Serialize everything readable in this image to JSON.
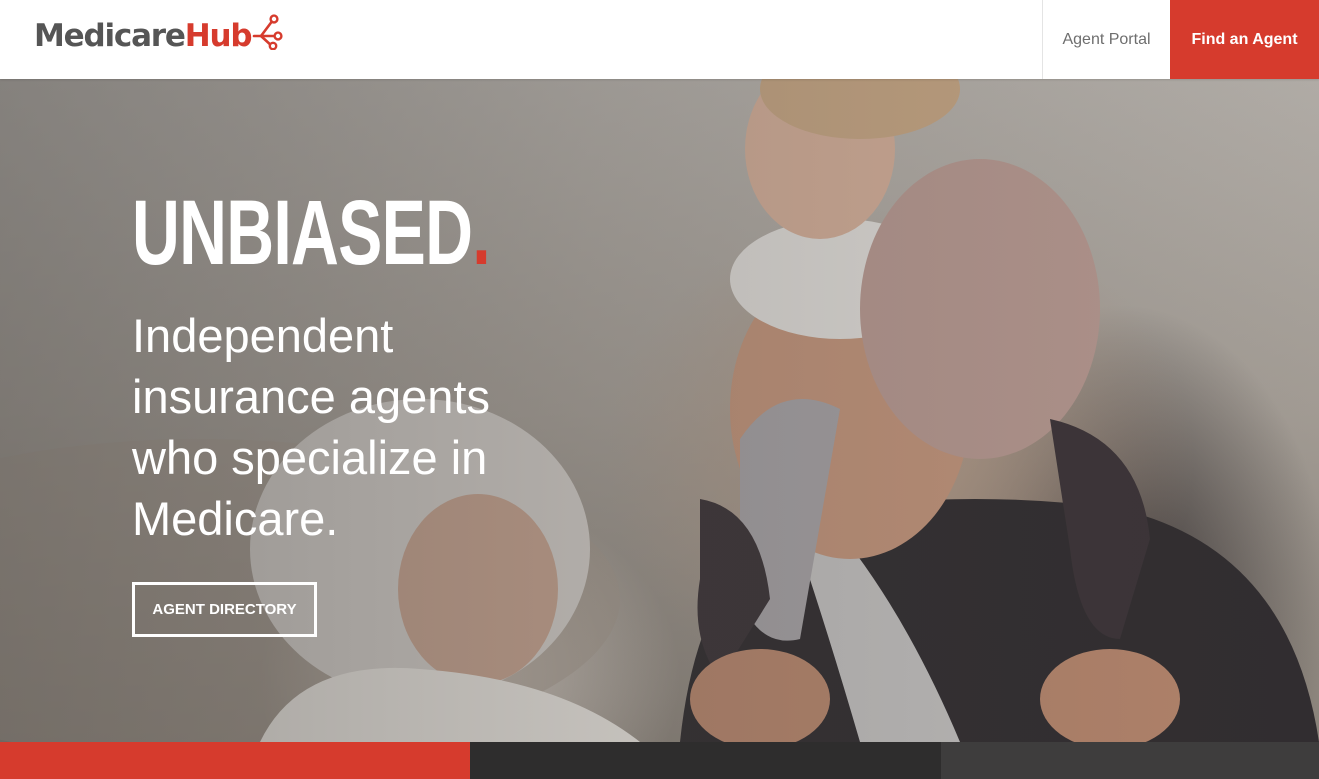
{
  "header": {
    "logo": {
      "part1": "Medicare",
      "part2": "Hub"
    },
    "nav": {
      "agent_portal": "Agent Portal",
      "find_agent": "Find an Agent"
    }
  },
  "hero": {
    "headline": "UNBIASED",
    "headline_dot": ".",
    "subhead": "Independent insurance agents who specialize in Medicare.",
    "cta_label": "AGENT DIRECTORY"
  },
  "colors": {
    "brand_red": "#d63b2d",
    "logo_gray": "#555555",
    "strip_dark": "#2e2d2d",
    "strip_mid": "#3e3d3d"
  },
  "icons": {
    "logo": "network-hub-icon"
  }
}
